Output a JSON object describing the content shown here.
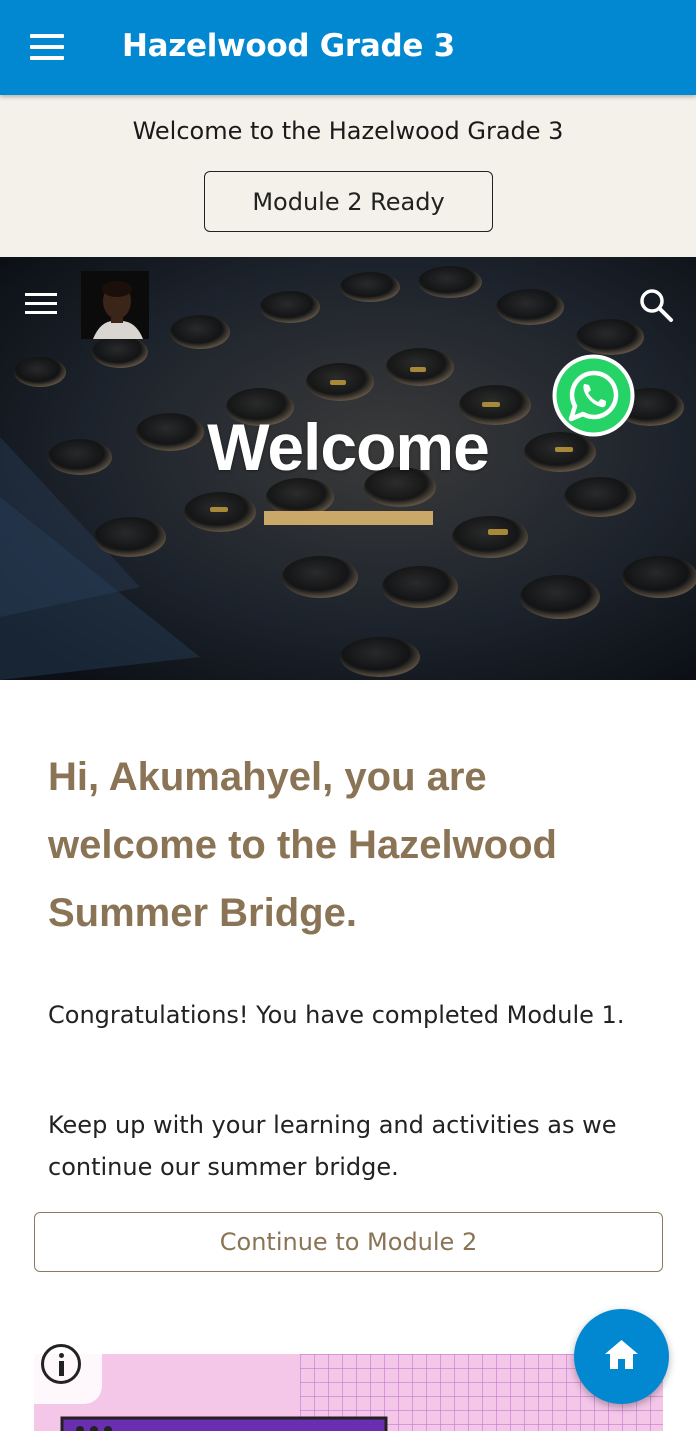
{
  "appbar": {
    "title": "Hazelwood Grade 3",
    "menu_icon": "hamburger-menu-icon",
    "background": "#0288d1"
  },
  "banner": {
    "text": "Welcome to the Hazelwood Grade 3",
    "button_label": "Module 2 Ready"
  },
  "hero": {
    "title": "Welcome",
    "menu_icon": "hamburger-menu-icon",
    "search_icon": "search-icon",
    "whatsapp_icon": "whatsapp-icon",
    "accent": "#c9a86a"
  },
  "content": {
    "heading": "Hi, Akumahyel, you are welcome to the Hazelwood Summer Bridge.",
    "paragraph1": "Congratulations! You have completed Module 1.",
    "paragraph2": "Keep up with your learning and activities as we continue our summer bridge.",
    "cta_label": "Continue to Module 2",
    "heading_color": "#8a7455"
  },
  "floating": {
    "info_icon": "info-icon",
    "home_icon": "home-icon"
  }
}
